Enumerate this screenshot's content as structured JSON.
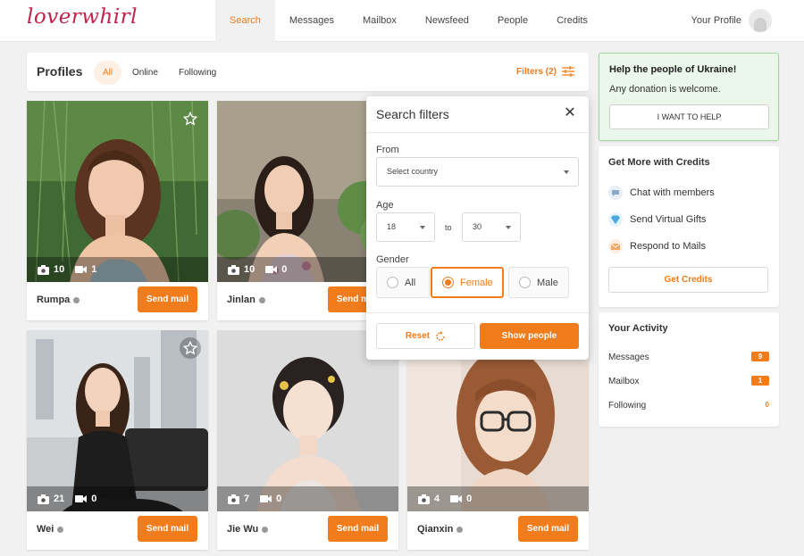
{
  "app": {
    "logo": "loverwhirl"
  },
  "nav": {
    "items": [
      "Search",
      "Messages",
      "Mailbox",
      "Newsfeed",
      "People",
      "Credits"
    ],
    "active": "Search",
    "profile_label": "Your Profile"
  },
  "profiles_bar": {
    "title": "Profiles",
    "tabs": [
      "All",
      "Online",
      "Following"
    ],
    "active_tab": "All",
    "filters_label": "Filters (2)"
  },
  "cards": [
    {
      "name": "Rumpa",
      "photos": "10",
      "videos": "1",
      "button": "Send mail"
    },
    {
      "name": "Jinlan",
      "photos": "10",
      "videos": "0",
      "button": "Send mail"
    },
    {
      "name": "Wei",
      "photos": "21",
      "videos": "0",
      "button": "Send mail"
    },
    {
      "name": "Jie Wu",
      "photos": "7",
      "videos": "0",
      "button": "Send mail"
    },
    {
      "name": "Qianxin",
      "photos": "4",
      "videos": "0",
      "button": "Send mail"
    }
  ],
  "filters_popup": {
    "title": "Search filters",
    "from_label": "From",
    "country_placeholder": "Select country",
    "age_label": "Age",
    "age_from": "18",
    "age_to": "30",
    "to_label": "to",
    "gender_label": "Gender",
    "gender_options": [
      "All",
      "Female",
      "Male"
    ],
    "gender_selected": "Female",
    "reset_label": "Reset",
    "show_label": "Show people"
  },
  "ukraine": {
    "title": "Help the people of Ukraine!",
    "subtitle": "Any donation is welcome.",
    "button": "I WANT TO HELP"
  },
  "credits_panel": {
    "title": "Get More with Credits",
    "items": [
      {
        "label": "Chat with members",
        "icon": "chat-icon"
      },
      {
        "label": "Send Virtual Gifts",
        "icon": "diamond-icon"
      },
      {
        "label": "Respond to Mails",
        "icon": "envelope-icon"
      }
    ],
    "button": "Get Credits"
  },
  "activity": {
    "title": "Your Activity",
    "rows": [
      {
        "label": "Messages",
        "count": "9"
      },
      {
        "label": "Mailbox",
        "count": "1"
      },
      {
        "label": "Following",
        "count": "0"
      }
    ]
  },
  "colors": {
    "accent": "#f07c1c",
    "logo": "#c0234b",
    "ukraine_bg": "#eaf7ea"
  }
}
